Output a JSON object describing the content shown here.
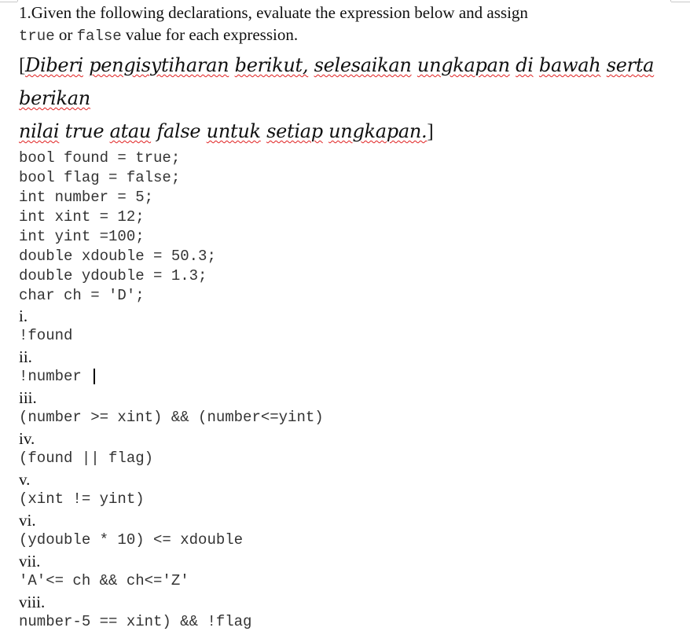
{
  "question": {
    "line1": "1.Given the following declarations, evaluate the expression below and assign",
    "line2_true": "true",
    "line2_or": " or ",
    "line2_false": "false",
    "line2_rest": " value for each expression.",
    "malay": {
      "open_bracket": "[",
      "words_line1": [
        "Diberi",
        "pengisytiharan",
        "berikut,",
        "selesaikan",
        "ungkapan",
        "di",
        "bawah",
        "serta"
      ],
      "words_line2": [
        "berikan"
      ],
      "words_line3": [
        "nilai",
        "true",
        "atau",
        "false",
        "untuk",
        "setiap",
        "ungkapan."
      ],
      "close_bracket": "]"
    }
  },
  "declarations": [
    "bool found = true;",
    "bool flag = false;",
    "int number = 5;",
    "int xint = 12;",
    "int yint =100;",
    "double xdouble = 50.3;",
    "double ydouble = 1.3;",
    "char ch = 'D';"
  ],
  "expressions": [
    {
      "label": "i.",
      "expr": "!found"
    },
    {
      "label": "ii.",
      "expr": "!number "
    },
    {
      "label": "iii.",
      "expr": "(number >= xint) && (number<=yint)"
    },
    {
      "label": "iv.",
      "expr": "(found || flag)"
    },
    {
      "label": "v.",
      "expr": "(xint != yint)"
    },
    {
      "label": "vi.",
      "expr": "(ydouble * 10) <= xdouble"
    },
    {
      "label": "vii.",
      "expr": "'A'<= ch && ch<='Z'"
    },
    {
      "label": "viii.",
      "expr": "number-5 == xint) && !flag"
    }
  ]
}
